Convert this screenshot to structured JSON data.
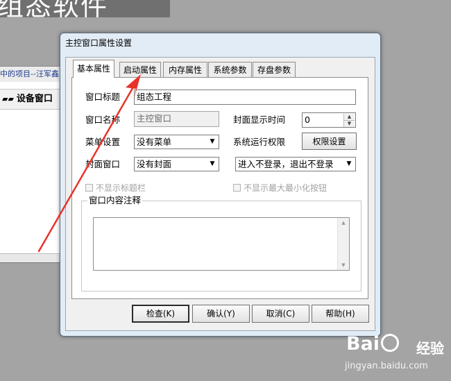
{
  "background": {
    "window_title": "组态软件",
    "breadcrumb": "中的项目--汪军鑫",
    "device_window_label": "设备窗口"
  },
  "dialog": {
    "title": "主控窗口属性设置",
    "tabs": [
      {
        "label": "基本属性",
        "active": true
      },
      {
        "label": "启动属性",
        "active": false
      },
      {
        "label": "内存属性",
        "active": false
      },
      {
        "label": "系统参数",
        "active": false
      },
      {
        "label": "存盘参数",
        "active": false
      }
    ],
    "fields": {
      "window_title_label": "窗口标题",
      "window_title_value": "组态工程",
      "window_name_label": "窗口名称",
      "window_name_value": "主控窗口",
      "cover_time_label": "封面显示时间",
      "cover_time_value": "0",
      "menu_label": "菜单设置",
      "menu_value": "没有菜单",
      "permission_label": "系统运行权限",
      "permission_button": "权限设置",
      "cover_window_label": "封面窗口",
      "cover_window_value": "没有封面",
      "login_value": "进入不登录，退出不登录"
    },
    "checkboxes": {
      "hide_titlebar": "不显示标题栏",
      "hide_minmax": "不显示最大最小化按钮"
    },
    "comment_group_label": "窗口内容注释",
    "buttons": {
      "check": "检查(K)",
      "confirm": "确认(Y)",
      "cancel": "取消(C)",
      "help": "帮助(H)"
    }
  },
  "watermark": {
    "logo": "Bai  经验",
    "url": "jingyan.baidu.com"
  },
  "colors": {
    "desktop": "#a4a4a4",
    "dialog_frame": "#e2ecf6",
    "arrow": "#e8332a"
  }
}
